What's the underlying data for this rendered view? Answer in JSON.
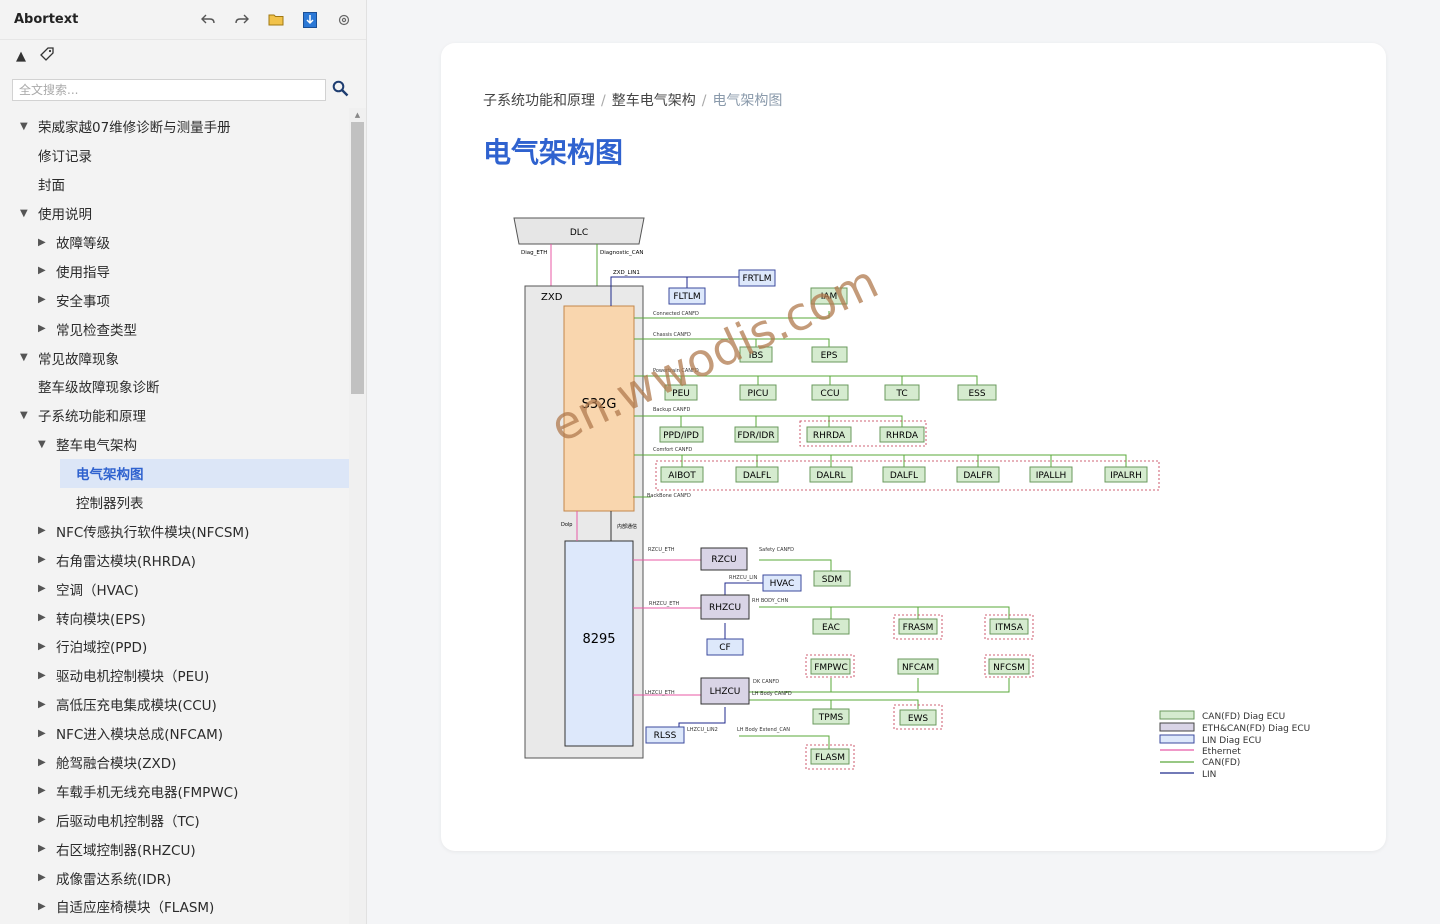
{
  "app": {
    "title": "Abortext"
  },
  "toolbar": {
    "back_icon": "undo-arrow-icon",
    "forward_icon": "redo-arrow-icon",
    "open_icon": "folder-icon",
    "download_icon": "download-icon",
    "settings_icon": "settings-icon",
    "collapse_glyph": "▲",
    "tag_glyph": "◇"
  },
  "search": {
    "placeholder": "全文搜索...",
    "value": ""
  },
  "tree": [
    {
      "label": "荣威家越07维修诊断与测量手册",
      "level": 0,
      "arrow": "▼"
    },
    {
      "label": "修订记录",
      "level": 1,
      "arrow": ""
    },
    {
      "label": "封面",
      "level": 1,
      "arrow": ""
    },
    {
      "label": "使用说明",
      "level": 0,
      "arrow": "▼"
    },
    {
      "label": "故障等级",
      "level": 1,
      "arrow": "▶"
    },
    {
      "label": "使用指导",
      "level": 1,
      "arrow": "▶"
    },
    {
      "label": "安全事项",
      "level": 1,
      "arrow": "▶"
    },
    {
      "label": "常见检查类型",
      "level": 1,
      "arrow": "▶"
    },
    {
      "label": "常见故障现象",
      "level": 0,
      "arrow": "▼"
    },
    {
      "label": "整车级故障现象诊断",
      "level": 1,
      "arrow": ""
    },
    {
      "label": "子系统功能和原理",
      "level": 0,
      "arrow": "▼"
    },
    {
      "label": "整车电气架构",
      "level": 1,
      "arrow": "▼"
    },
    {
      "label": "电气架构图",
      "level": 2,
      "arrow": "",
      "selected": true
    },
    {
      "label": "控制器列表",
      "level": 2,
      "arrow": ""
    },
    {
      "label": "NFC传感执行软件模块(NFCSM)",
      "level": 1,
      "arrow": "▶"
    },
    {
      "label": "右角雷达模块(RHRDA)",
      "level": 1,
      "arrow": "▶"
    },
    {
      "label": "空调（HVAC)",
      "level": 1,
      "arrow": "▶"
    },
    {
      "label": "转向模块(EPS)",
      "level": 1,
      "arrow": "▶"
    },
    {
      "label": "行泊域控(PPD)",
      "level": 1,
      "arrow": "▶"
    },
    {
      "label": "驱动电机控制模块（PEU)",
      "level": 1,
      "arrow": "▶"
    },
    {
      "label": "高低压充电集成模块(CCU)",
      "level": 1,
      "arrow": "▶"
    },
    {
      "label": "NFC进入模块总成(NFCAM)",
      "level": 1,
      "arrow": "▶"
    },
    {
      "label": "舱驾融合模块(ZXD)",
      "level": 1,
      "arrow": "▶"
    },
    {
      "label": "车载手机无线充电器(FMPWC)",
      "level": 1,
      "arrow": "▶"
    },
    {
      "label": "后驱动电机控制器（TC)",
      "level": 1,
      "arrow": "▶"
    },
    {
      "label": "右区域控制器(RHZCU)",
      "level": 1,
      "arrow": "▶"
    },
    {
      "label": "成像雷达系统(IDR)",
      "level": 1,
      "arrow": "▶"
    },
    {
      "label": "自适应座椅模块（FLASM)",
      "level": 1,
      "arrow": "▶"
    }
  ],
  "breadcrumb": {
    "items": [
      "子系统功能和原理",
      "整车电气架构",
      "电气架构图"
    ],
    "separator": "/"
  },
  "page": {
    "title": "电气架构图"
  },
  "diagram": {
    "dlc": "DLC",
    "zxd": "ZXD",
    "s32g": "S32G",
    "chip8295": "8295",
    "watermark": "en.wwodis.com",
    "buses": {
      "diag_eth": "Diag_ETH",
      "diag_can": "Diagnostic_CAN",
      "zxd_lin1": "ZXD_LIN1",
      "connected": "Connected CANFD",
      "chassis": "Chassis CANFD",
      "powertrain": "Powertrain CANFD",
      "backup": "Backup CANFD",
      "comfort": "Comfort CANFD",
      "backbone": "BackBone CANFD",
      "dolp": "Dolp",
      "internal": "内部通信",
      "rzcu_eth": "RZCU_ETH",
      "safety": "Safety CANFD",
      "rhzcu_lin": "RHZCU_LIN",
      "rhzcu_eth": "RHZCU_ETH",
      "rh_body": "RH BODY_CHN",
      "dk_canfd": "DK CANFD",
      "lhzcu_eth": "LHZCU_ETH",
      "lh_body": "LH Body CANFD",
      "lhzcu_lin2": "LHZCU_LIN2",
      "lh_ext": "LH Body Extend_CAN"
    },
    "ecus": {
      "frtlm": "FRTLM",
      "fltlm": "FLTLM",
      "iam": "IAM",
      "ibs": "IBS",
      "eps": "EPS",
      "peu": "PEU",
      "picu": "PICU",
      "ccu": "CCU",
      "tc": "TC",
      "ess": "ESS",
      "ppd": "PPD/IPD",
      "fdr": "FDR/IDR",
      "rhrda1": "RHRDA",
      "rhrda2": "RHRDA",
      "aibot": "AIBOT",
      "dalfl1": "DALFL",
      "dalrl": "DALRL",
      "dalfl2": "DALFL",
      "dalfr": "DALFR",
      "ipallh": "IPALLH",
      "ipalrh": "IPALRH",
      "rzcu": "RZCU",
      "sdm": "SDM",
      "hvac": "HVAC",
      "rhzcu": "RHZCU",
      "eac": "EAC",
      "frasm": "FRASM",
      "itmsa": "ITMSA",
      "cf": "CF",
      "fmpwc": "FMPWC",
      "nfcam": "NFCAM",
      "nfcsm": "NFCSM",
      "lhzcu": "LHZCU",
      "tpms": "TPMS",
      "ews": "EWS",
      "rlss": "RLSS",
      "flasm": "FLASM"
    },
    "legend": [
      {
        "label": "CAN(FD) Diag ECU",
        "kind": "box",
        "color": "#d5ebcf",
        "stroke": "#6a9a5c"
      },
      {
        "label": "ETH&CAN(FD) Diag ECU",
        "kind": "box",
        "color": "#d9d4e6",
        "stroke": "#444"
      },
      {
        "label": "LIN Diag ECU",
        "kind": "box",
        "color": "#dde8fb",
        "stroke": "#3b4a9c"
      },
      {
        "label": "Ethernet",
        "kind": "line",
        "color": "#e85aa6"
      },
      {
        "label": "CAN(FD)",
        "kind": "line",
        "color": "#5aa83a"
      },
      {
        "label": "LIN",
        "kind": "line",
        "color": "#1f2a8c"
      }
    ],
    "colors": {
      "can": "#5aa83a",
      "eth": "#e85aa6",
      "lin": "#1f2a8c",
      "can_ecu_fill": "#d5ebcf",
      "eth_ecu_fill": "#d9d4e6",
      "lin_ecu_fill": "#dde8fb",
      "s32g_fill": "#f9d6ae",
      "chip_fill": "#dde8fb",
      "accent": "#2f62cf"
    }
  }
}
